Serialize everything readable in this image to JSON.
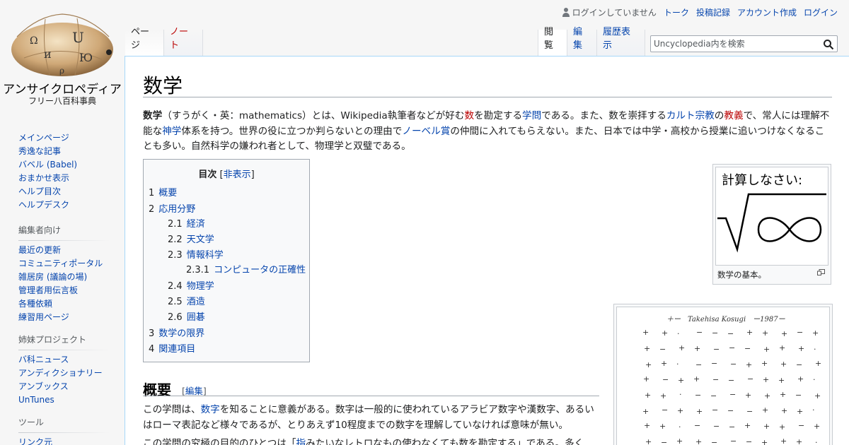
{
  "logo": {
    "site_name": "アンサイクロペディア",
    "tagline": "フリー八百科事典"
  },
  "personal": {
    "status": "ログインしていません",
    "talk": "トーク",
    "contributions": "投稿記録",
    "create_account": "アカウント作成",
    "login": "ログイン"
  },
  "tabs": {
    "page": "ページ",
    "note": "ノート",
    "read": "閲覧",
    "edit": "編集",
    "history": "履歴表示"
  },
  "search": {
    "placeholder": "Uncyclopedia内を検索"
  },
  "article": {
    "title": "数学",
    "intro": {
      "t1": "数学",
      "t2": "（すうがく・英：mathematics）とは、Wikipedia執筆者などが好む",
      "l1": "数",
      "t3": "を勘定する",
      "l2": "学問",
      "t4": "である。また、数を崇拝する",
      "l3": "カルト",
      "l4": "宗教",
      "t5": "の",
      "l5": "教義",
      "t6": "で、常人には理解不能な",
      "l6": "神学",
      "t7": "体系を持つ。世界の役に立つか判らないとの理由で",
      "l7": "ノーベル賞",
      "t8": "の仲間に入れてもらえない。また、日本では中学・高校から授業に追いつけなくなることも多い。自然科学の嫌われ者として、物理学と双璧である。"
    },
    "toc": {
      "title": "目次",
      "bracket_open": "[",
      "hide": "非表示",
      "bracket_close": "]",
      "items": [
        {
          "num": "1",
          "label": "概要"
        },
        {
          "num": "2",
          "label": "応用分野"
        },
        {
          "num": "2.1",
          "label": "経済"
        },
        {
          "num": "2.2",
          "label": "天文学"
        },
        {
          "num": "2.3",
          "label": "情報科学"
        },
        {
          "num": "2.3.1",
          "label": "コンピュータの正確性"
        },
        {
          "num": "2.4",
          "label": "物理学"
        },
        {
          "num": "2.5",
          "label": "酒造"
        },
        {
          "num": "2.6",
          "label": "囲碁"
        },
        {
          "num": "3",
          "label": "数学の限界"
        },
        {
          "num": "4",
          "label": "関連項目"
        }
      ]
    },
    "section1": {
      "title": "概要",
      "edit_open": "[",
      "edit": "編集",
      "edit_close": "]",
      "p1a": "この学問は、",
      "p1link": "数字",
      "p1b": "を知ることに意義がある。数字は一般的に使われているアラビア数字や漢数字、あるいはローマ表記など様々であるが、とりあえず10程度までの数字を理解していなければ意味が無い。",
      "p2a": "この学問の究極の目的のひとつは「",
      "p2link": "指",
      "p2b": "みたいなレトロなもの使わなくても数を勘定する」である。多く"
    },
    "thumb1": {
      "image_text": "計算しなさい:",
      "caption": "数学の基本。"
    },
    "thumb2": {
      "header": "＋ー　Takehisa Kosugi　ー1987ー"
    }
  },
  "sidebar": {
    "main": [
      "メインページ",
      "秀逸な記事",
      "バベル (Babel)",
      "おまかせ表示",
      "ヘルプ目次",
      "ヘルプデスク"
    ],
    "editors_head": "編集者向け",
    "editors": [
      "最近の更新",
      "コミュニティポータル",
      "雑居房 (議論の場)",
      "管理者用伝言板",
      "各種依頼",
      "練習用ページ"
    ],
    "sister_head": "姉妹プロジェクト",
    "sister": [
      "バ科ニュース",
      "アンディクショナリー",
      "アンブックス",
      "UnTunes"
    ],
    "tools_head": "ツール",
    "tools": [
      "リンク元"
    ]
  }
}
